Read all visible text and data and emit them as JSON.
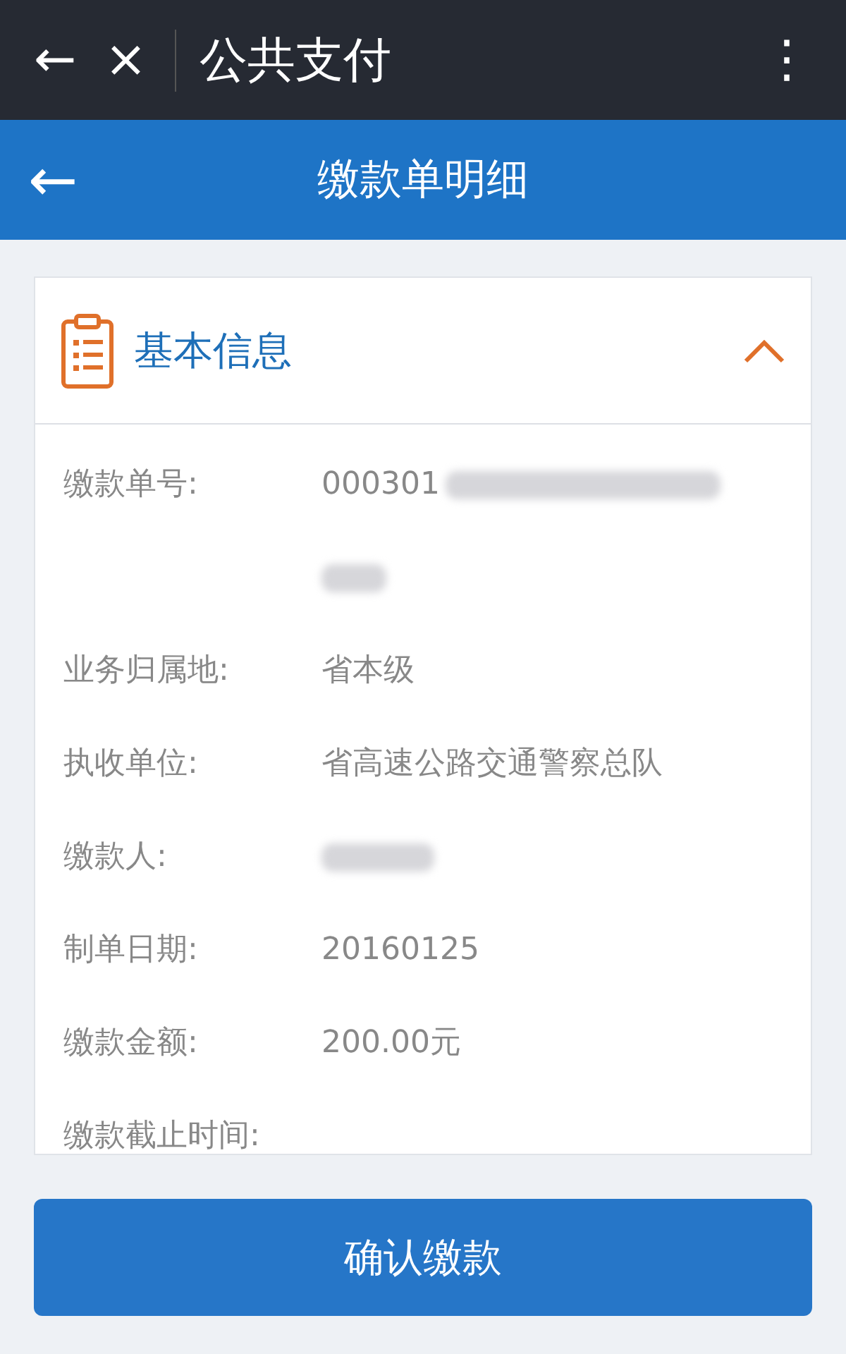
{
  "top_bar": {
    "back": "←",
    "close": "×",
    "title": "公共支付",
    "menu": "⋮"
  },
  "header": {
    "back": "←",
    "title": "缴款单明细"
  },
  "section": {
    "title": "基本信息",
    "expanded": true,
    "rows": [
      {
        "label": "缴款单号:",
        "value": "000301",
        "kind": "partly_blurred"
      },
      {
        "label": "业务归属地:",
        "value": "省本级",
        "kind": "plain"
      },
      {
        "label": "执收单位:",
        "value": "省高速公路交通警察总队",
        "kind": "plain"
      },
      {
        "label": "缴款人:",
        "kind": "blurred"
      },
      {
        "label": "制单日期:",
        "value": "20160125",
        "kind": "plain"
      },
      {
        "label": "缴款金额:",
        "value": "200.00元",
        "kind": "plain"
      },
      {
        "label": "缴款截止时间:",
        "kind": "empty"
      }
    ]
  },
  "confirm_button": "确认缴款"
}
